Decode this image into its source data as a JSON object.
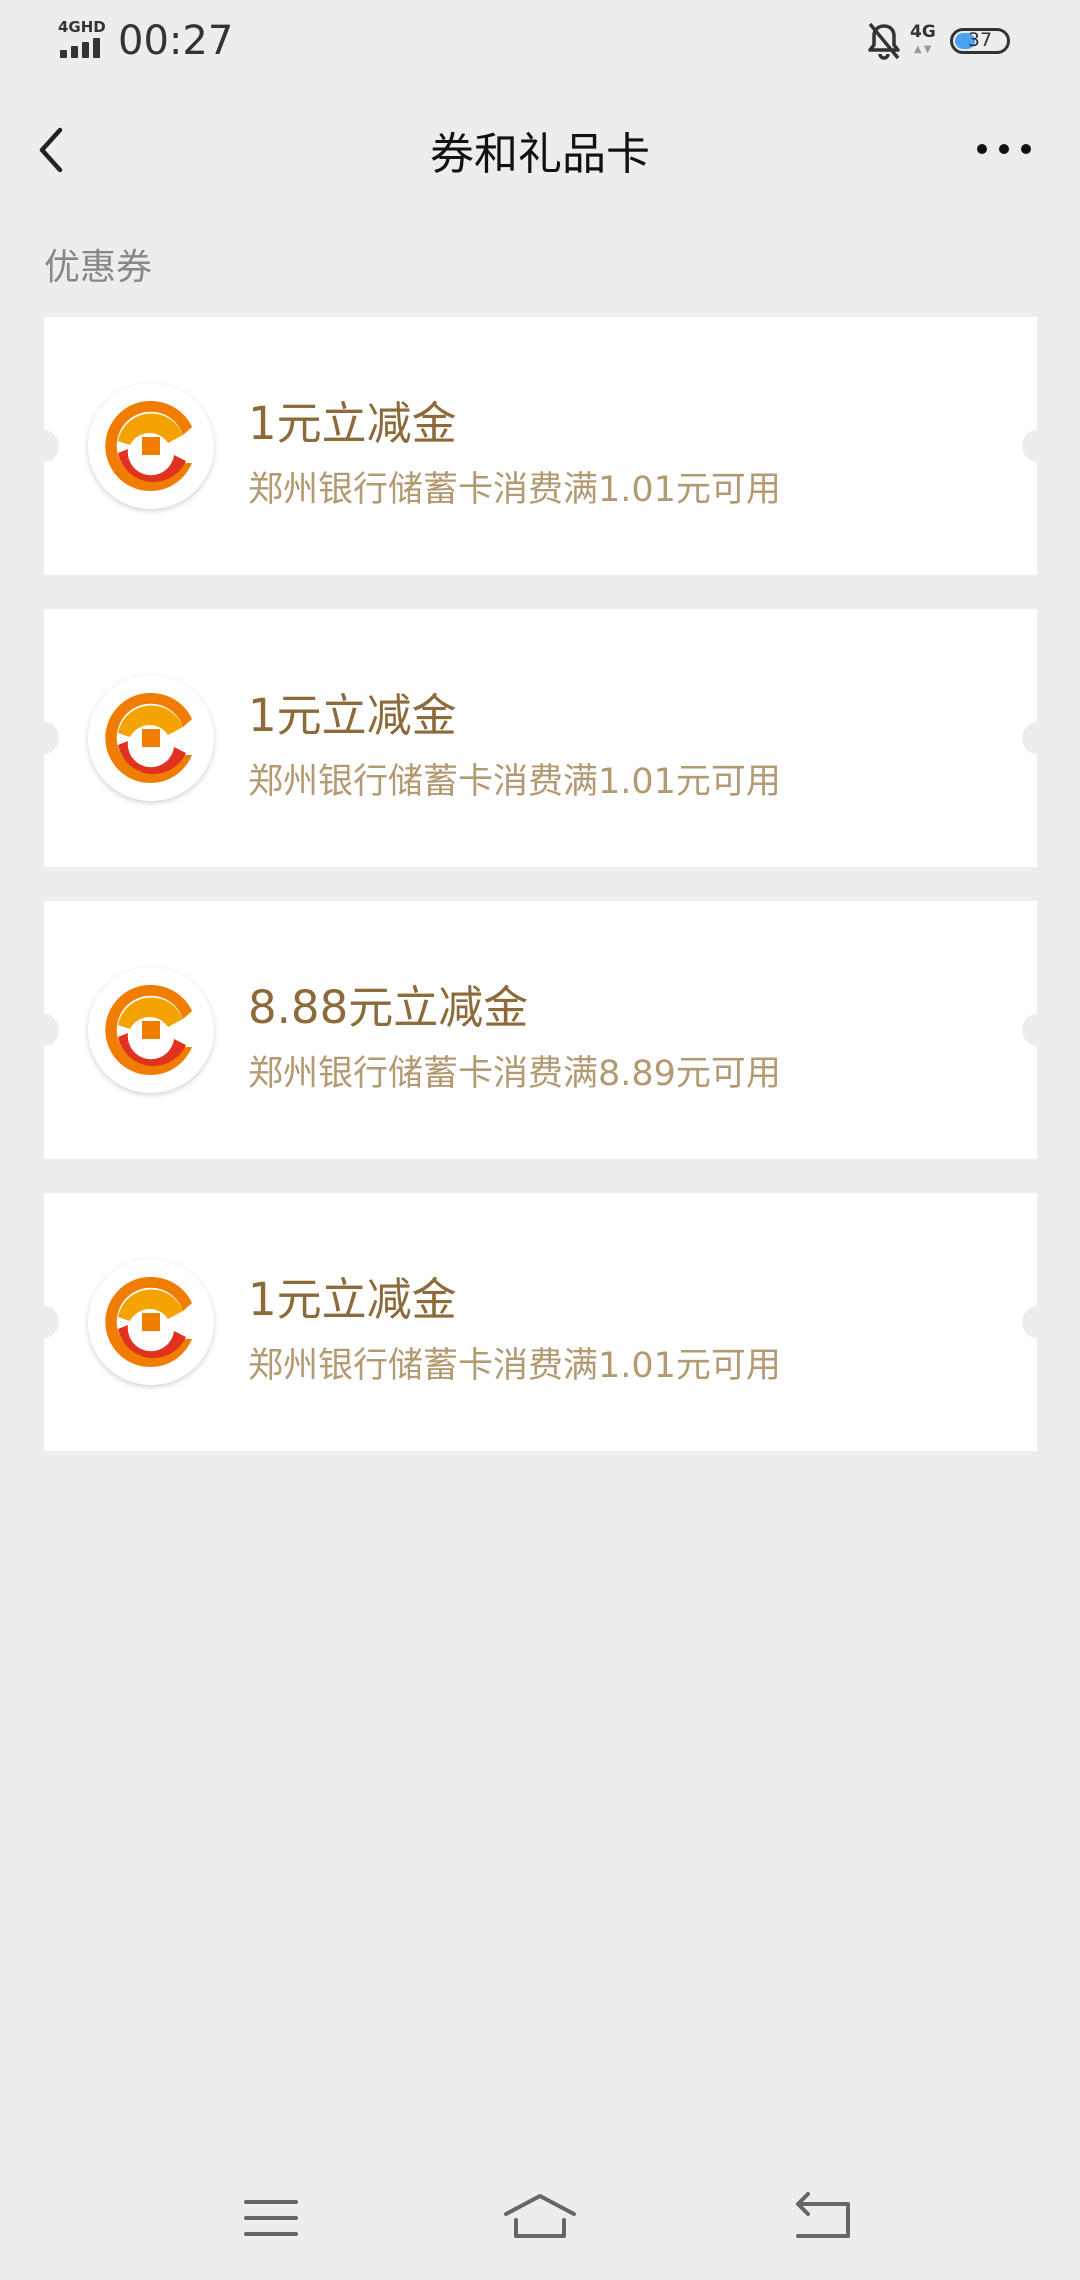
{
  "status_bar": {
    "network_label": "4GHD",
    "time": "00:27",
    "secondary_network": "4G",
    "battery": "37",
    "icons": [
      "signal-icon",
      "bell-off-icon",
      "battery-icon"
    ]
  },
  "header": {
    "title": "券和礼品卡",
    "back_icon": "chevron-left-icon",
    "more_icon": "more-horizontal-icon"
  },
  "section": {
    "label": "优惠券"
  },
  "coupons": [
    {
      "title": "1元立减金",
      "description": "郑州银行储蓄卡消费满1.01元可用"
    },
    {
      "title": "1元立减金",
      "description": "郑州银行储蓄卡消费满1.01元可用"
    },
    {
      "title": "8.88元立减金",
      "description": "郑州银行储蓄卡消费满8.89元可用"
    },
    {
      "title": "1元立减金",
      "description": "郑州银行储蓄卡消费满1.01元可用"
    }
  ],
  "bottom_nav": {
    "icons": [
      "menu-icon",
      "home-icon",
      "back-icon"
    ]
  },
  "colors": {
    "background": "#ededed",
    "card": "#ffffff",
    "coupon_title": "#8c6a3a",
    "coupon_desc": "#b39a72",
    "logo_orange": "#f07d00",
    "logo_red": "#e0321e"
  }
}
